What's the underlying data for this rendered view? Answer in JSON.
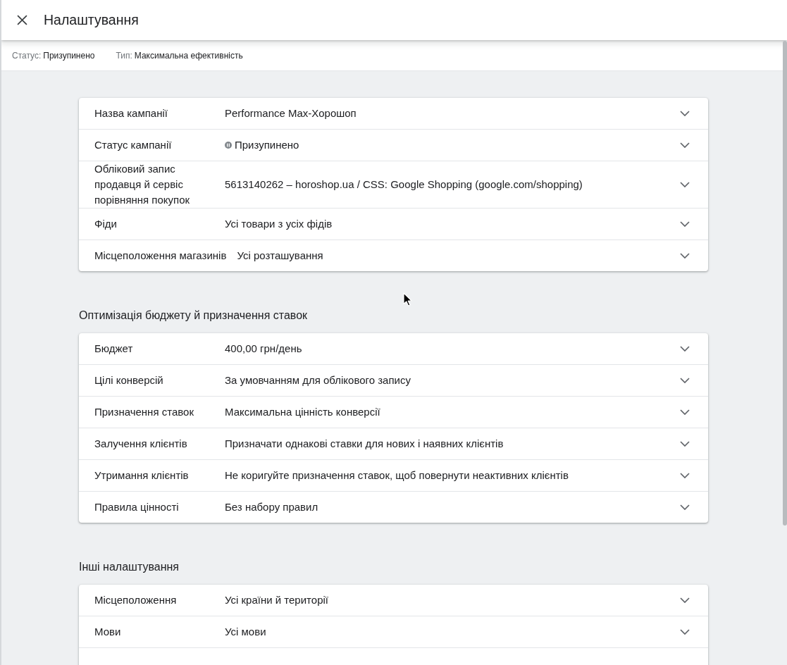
{
  "header": {
    "title": "Налаштування"
  },
  "summary": [
    {
      "label": "Статус:",
      "value": "Призупинено"
    },
    {
      "label": "Тип:",
      "value": "Максимальна ефективність"
    }
  ],
  "sections": [
    {
      "rows": [
        {
          "kind": "text",
          "label": "Назва кампанії",
          "value": "Performance Max-Хорошоп",
          "expanded": false
        },
        {
          "kind": "status",
          "label": "Статус кампанії",
          "value": "Призупинено",
          "expanded": false
        },
        {
          "kind": "text",
          "label": "Обліковий запис продавця й сервіс порівняння покупок",
          "value": "5613140262 – horoshop.ua / CSS: Google Shopping (google.com/shopping)",
          "expanded": false
        },
        {
          "kind": "text",
          "label": "Фіди",
          "value": "Усі товари з усіх фідів",
          "expanded": false
        },
        {
          "kind": "wide",
          "label": "Місцеположення магазинів",
          "value": "Усі розташування",
          "expanded": false
        }
      ]
    },
    {
      "title": "Оптимізація бюджету й призначення ставок",
      "rows": [
        {
          "kind": "text",
          "label": "Бюджет",
          "value": "400,00 грн/день",
          "expanded": false
        },
        {
          "kind": "text",
          "label": "Цілі конверсій",
          "value": "За умовчанням для облікового запису",
          "expanded": false
        },
        {
          "kind": "text",
          "label": "Призначення ставок",
          "value": "Максимальна цінність конверсії",
          "expanded": false
        },
        {
          "kind": "text",
          "label": "Залучення клієнтів",
          "value": "Призначати однакові ставки для нових і наявних клієнтів",
          "expanded": false
        },
        {
          "kind": "text",
          "label": "Утримання клієнтів",
          "value": "Не коригуйте призначення ставок, щоб повернути неактивних клієнтів",
          "expanded": false
        },
        {
          "kind": "text",
          "label": "Правила цінності",
          "value": "Без набору правил",
          "expanded": false
        }
      ]
    },
    {
      "title": "Інші налаштування",
      "rows": [
        {
          "kind": "text",
          "label": "Місцеположення",
          "value": "Усі країни й території",
          "expanded": false
        },
        {
          "kind": "text",
          "label": "Мови",
          "value": "Усі мови",
          "expanded": false
        }
      ]
    }
  ]
}
